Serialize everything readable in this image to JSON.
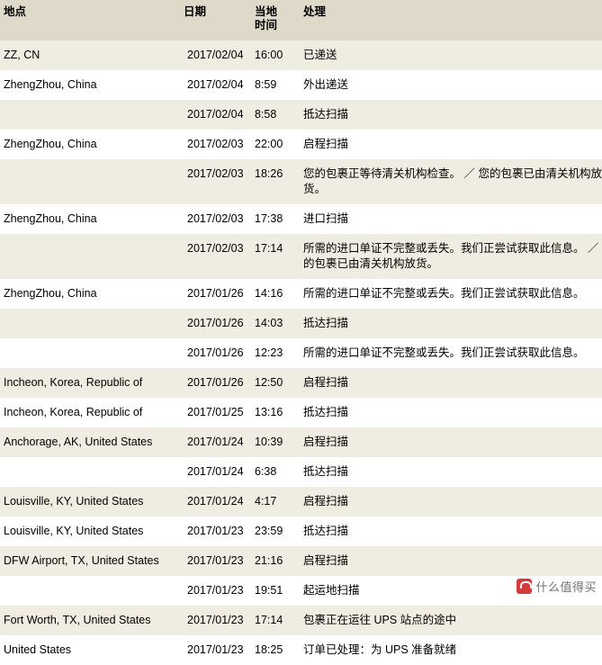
{
  "table": {
    "headers": {
      "location": "地点",
      "date": "日期",
      "local_time": "当地\n时间",
      "local_time_line1": "当地",
      "local_time_line2": "时间",
      "activity": "处理"
    },
    "rows": [
      {
        "location": "ZZ, CN",
        "date": "2017/02/04",
        "time": "16:00",
        "activity": "已递送"
      },
      {
        "location": "ZhengZhou, China",
        "date": "2017/02/04",
        "time": "8:59",
        "activity": "外出递送"
      },
      {
        "location": "",
        "date": "2017/02/04",
        "time": "8:58",
        "activity": "抵达扫描"
      },
      {
        "location": "ZhengZhou, China",
        "date": "2017/02/03",
        "time": "22:00",
        "activity": "启程扫描"
      },
      {
        "location": "",
        "date": "2017/02/03",
        "time": "18:26",
        "activity": "您的包裹正等待清关机构检查。 ／ 您的包裹已由清关机构放货。"
      },
      {
        "location": "ZhengZhou, China",
        "date": "2017/02/03",
        "time": "17:38",
        "activity": "进口扫描"
      },
      {
        "location": "",
        "date": "2017/02/03",
        "time": "17:14",
        "activity": "所需的进口单证不完整或丢失。我们正尝试获取此信息。 ／ 您的包裹已由清关机构放货。"
      },
      {
        "location": "ZhengZhou, China",
        "date": "2017/01/26",
        "time": "14:16",
        "activity": "所需的进口单证不完整或丢失。我们正尝试获取此信息。"
      },
      {
        "location": "",
        "date": "2017/01/26",
        "time": "14:03",
        "activity": "抵达扫描"
      },
      {
        "location": "",
        "date": "2017/01/26",
        "time": "12:23",
        "activity": "所需的进口单证不完整或丢失。我们正尝试获取此信息。"
      },
      {
        "location": "Incheon, Korea, Republic of",
        "date": "2017/01/26",
        "time": "12:50",
        "activity": "启程扫描"
      },
      {
        "location": "Incheon, Korea, Republic of",
        "date": "2017/01/25",
        "time": "13:16",
        "activity": "抵达扫描"
      },
      {
        "location": "Anchorage, AK, United States",
        "date": "2017/01/24",
        "time": "10:39",
        "activity": "启程扫描"
      },
      {
        "location": "",
        "date": "2017/01/24",
        "time": "6:38",
        "activity": "抵达扫描"
      },
      {
        "location": "Louisville, KY, United States",
        "date": "2017/01/24",
        "time": "4:17",
        "activity": "启程扫描"
      },
      {
        "location": "Louisville, KY, United States",
        "date": "2017/01/23",
        "time": "23:59",
        "activity": "抵达扫描"
      },
      {
        "location": "DFW Airport, TX, United States",
        "date": "2017/01/23",
        "time": "21:16",
        "activity": "启程扫描"
      },
      {
        "location": "",
        "date": "2017/01/23",
        "time": "19:51",
        "activity": "起运地扫描"
      },
      {
        "location": "Fort Worth, TX, United States",
        "date": "2017/01/23",
        "time": "17:14",
        "activity": "包裹正在运往 UPS 站点的途中"
      },
      {
        "location": "United States",
        "date": "2017/01/23",
        "time": "18:25",
        "activity": "订单已处理：为 UPS 准备就绪"
      }
    ]
  },
  "watermark": {
    "text": "什么值得买"
  }
}
